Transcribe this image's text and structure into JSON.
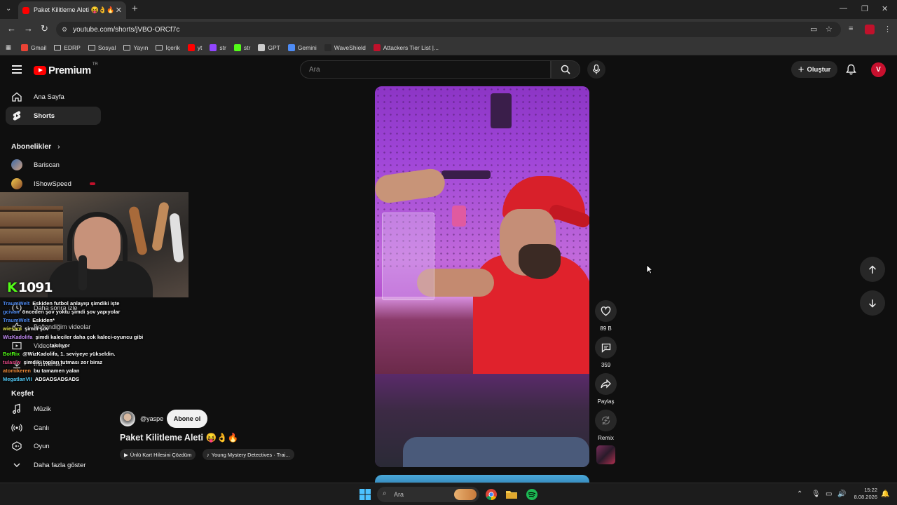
{
  "browser": {
    "tab_title": "Paket Kilitleme Aleti 😝👌🔥",
    "url": "youtube.com/shorts/jVBO-ORCf7c",
    "bookmarks": [
      {
        "label": "Gmail",
        "icon": "gmail-icon",
        "color": "#ea4335"
      },
      {
        "label": "EDRP",
        "icon": "folder-icon",
        "color": ""
      },
      {
        "label": "Sosyal",
        "icon": "folder-icon",
        "color": ""
      },
      {
        "label": "Yayın",
        "icon": "folder-icon",
        "color": ""
      },
      {
        "label": "İçerik",
        "icon": "folder-icon",
        "color": ""
      },
      {
        "label": "yt",
        "icon": "youtube-icon",
        "color": "#ff0000"
      },
      {
        "label": "str",
        "icon": "twitch-icon",
        "color": "#9146ff"
      },
      {
        "label": "str",
        "icon": "kick-icon",
        "color": "#53fc18"
      },
      {
        "label": "GPT",
        "icon": "chatgpt-icon",
        "color": "#cccccc"
      },
      {
        "label": "Gemini",
        "icon": "gemini-icon",
        "color": "#4e8cf5"
      },
      {
        "label": "WaveShield",
        "icon": "waveshield-icon",
        "color": "#2a2a2a"
      },
      {
        "label": "Attackers Tier List |...",
        "icon": "tierlist-icon",
        "color": "#c0112b"
      }
    ]
  },
  "youtube": {
    "logo_text": "Premium",
    "country_code": "TR",
    "search_placeholder": "Ara",
    "create_label": "Oluştur",
    "avatar_letter": "V"
  },
  "sidebar": {
    "home": "Ana Sayfa",
    "shorts": "Shorts",
    "subscriptions_header": "Abonelikler",
    "subs": [
      {
        "name": "Bariscan"
      },
      {
        "name": "IShowSpeed"
      }
    ],
    "hidden_items": [
      "Daha sonra izle",
      "Beğendiğim videolar",
      "Videolarınız",
      "İndirilenler"
    ],
    "explore_header": "Keşfet",
    "explore": [
      "Müzik",
      "Canlı",
      "Oyun",
      "Daha fazla göster"
    ]
  },
  "overlay": {
    "viewer_count": "1091",
    "chat": [
      {
        "user": "TraumWelt",
        "color": "#4f8cf5",
        "msg": "Eskiden futbol anlayışı şimdiki işte"
      },
      {
        "user": "gcivan",
        "color": "#4f8cf5",
        "msg": "önceden şov yoktu şimdi şov yapıyolar"
      },
      {
        "user": "TraumWelt",
        "color": "#4f8cf5",
        "msg": "Eskiden*"
      },
      {
        "user": "wiesam",
        "color": "#e0e04a",
        "msg": "şimdi şov"
      },
      {
        "user": "WizKadolifa",
        "color": "#c38cf5",
        "msg": "şimdi kaleciler daha çok kaleci-oyuncu gibi"
      },
      {
        "user": "",
        "color": "#ffffff",
        "msg": "takılıyor"
      },
      {
        "user": "BotRix",
        "color": "#53fc18",
        "msg": "@WizKadolifa, 1. seviyeye yükseldin."
      },
      {
        "user": "tulasiw",
        "color": "#e94a8a",
        "msg": "şimdiki topları tutması zor biraz"
      },
      {
        "user": "atomikeren",
        "color": "#f08c3a",
        "msg": "bu tamamen yalan"
      },
      {
        "user": "MegatlanVII",
        "color": "#53c9f5",
        "msg": "ADSADSADSADS"
      }
    ]
  },
  "short": {
    "channel": "@yaspe",
    "subscribe_label": "Abone ol",
    "title": "Paket Kilitleme Aleti 😝👌🔥",
    "chips": [
      "Ünlü Kart Hilesini Çözdüm",
      "Young Mystery Detectives · Trai..."
    ],
    "likes": "89 B",
    "comments": "359",
    "share_label": "Paylaş",
    "remix_label": "Remix"
  },
  "taskbar": {
    "search_placeholder": "Ara",
    "time": "15:22",
    "date": "8.08.2026"
  }
}
